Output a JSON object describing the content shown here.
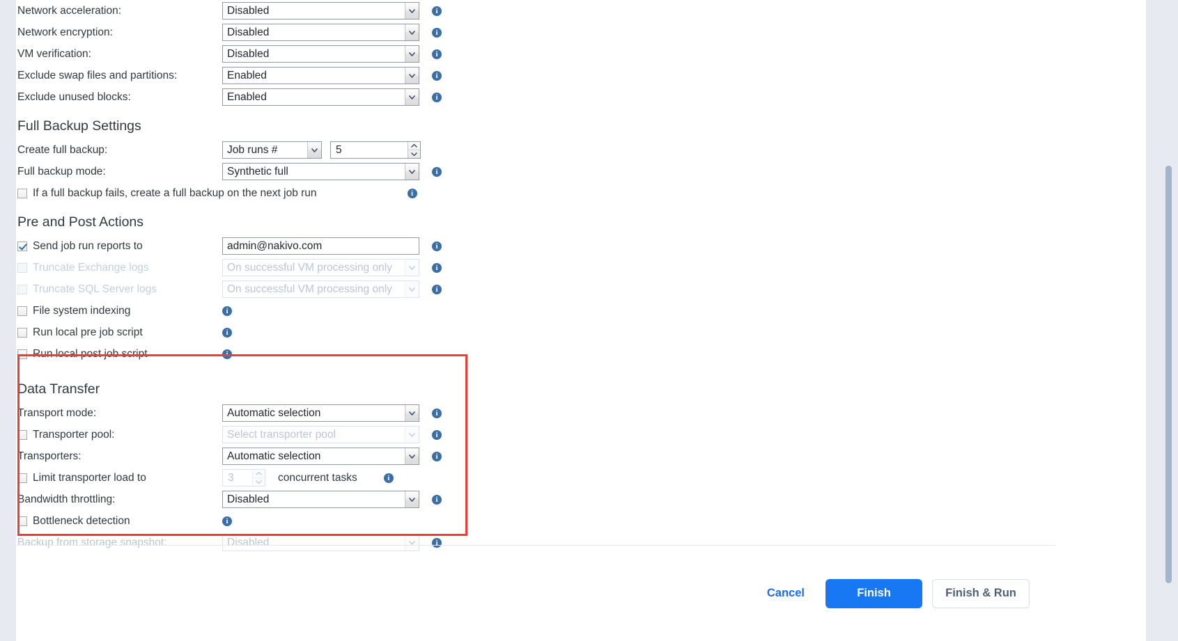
{
  "top_settings": [
    {
      "label": "Network acceleration:",
      "value": "Disabled",
      "disabled": false
    },
    {
      "label": "Network encryption:",
      "value": "Disabled",
      "disabled": false
    },
    {
      "label": "VM verification:",
      "value": "Disabled",
      "disabled": false
    },
    {
      "label": "Exclude swap files and partitions:",
      "value": "Enabled",
      "disabled": false
    },
    {
      "label": "Exclude unused blocks:",
      "value": "Enabled",
      "disabled": false
    }
  ],
  "full_backup": {
    "title": "Full Backup Settings",
    "create_full_backup_label": "Create full backup:",
    "create_full_backup_value": "Job runs #",
    "create_full_backup_count": "5",
    "full_backup_mode_label": "Full backup mode:",
    "full_backup_mode_value": "Synthetic full",
    "fail_checkbox_label": "If a full backup fails, create a full backup on the next job run"
  },
  "pre_post": {
    "title": "Pre and Post Actions",
    "send_reports_label": "Send job run reports to",
    "send_reports_value": "admin@nakivo.com",
    "truncate_exchange_label": "Truncate Exchange logs",
    "truncate_exchange_value": "On successful VM processing only",
    "truncate_sql_label": "Truncate SQL Server logs",
    "truncate_sql_value": "On successful VM processing only",
    "file_indexing_label": "File system indexing",
    "pre_script_label": "Run local pre job script",
    "post_script_label": "Run local post job script"
  },
  "data_transfer": {
    "title": "Data Transfer",
    "transport_mode_label": "Transport mode:",
    "transport_mode_value": "Automatic selection",
    "transporter_pool_label": "Transporter pool:",
    "transporter_pool_placeholder": "Select transporter pool",
    "transporters_label": "Transporters:",
    "transporters_value": "Automatic selection",
    "limit_load_label": "Limit transporter load to",
    "limit_load_value": "3",
    "concurrent_tasks_label": "concurrent tasks",
    "bandwidth_label": "Bandwidth throttling:",
    "bandwidth_value": "Disabled",
    "bottleneck_label": "Bottleneck detection",
    "storage_snapshot_label": "Backup from storage snapshot:",
    "storage_snapshot_value": "Disabled"
  },
  "footer": {
    "cancel_label": "Cancel",
    "finish_label": "Finish",
    "finish_run_label": "Finish & Run"
  },
  "colors": {
    "highlight": "#ec3c3c",
    "primary_button": "#1877f2",
    "link": "#1b6ef3",
    "info_icon": "#3a6ea5"
  }
}
